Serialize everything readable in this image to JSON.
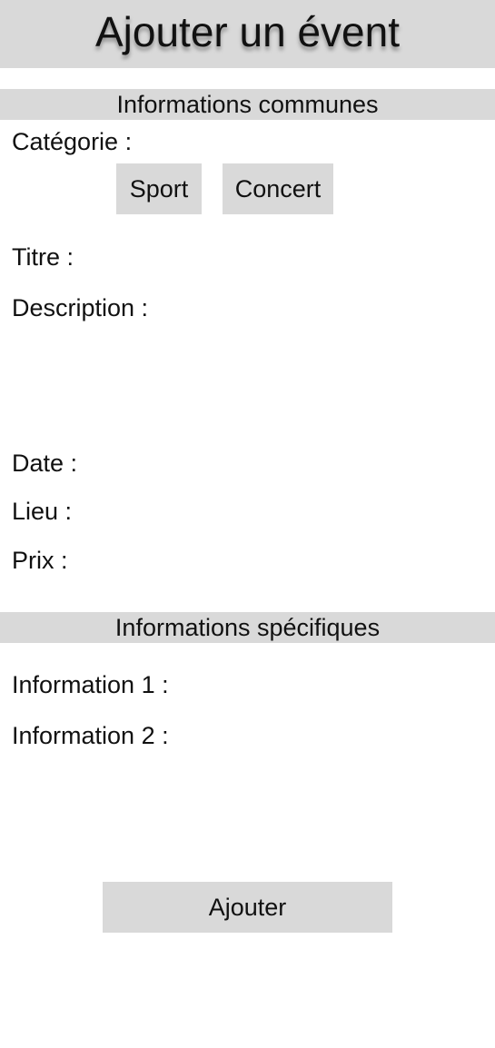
{
  "header": {
    "title": "Ajouter un évent"
  },
  "sections": {
    "common": "Informations communes",
    "specific": "Informations spécifiques"
  },
  "fields": {
    "category": "Catégorie :",
    "title": "Titre :",
    "description": "Description :",
    "date": "Date :",
    "place": "Lieu :",
    "price": "Prix :",
    "info1": "Information 1 :",
    "info2": "Information 2 :"
  },
  "categories": {
    "sport": "Sport",
    "concert": "Concert"
  },
  "actions": {
    "submit": "Ajouter"
  },
  "colors": {
    "bar": "#d9d9d9",
    "background": "#ffffff",
    "text": "#111111"
  }
}
